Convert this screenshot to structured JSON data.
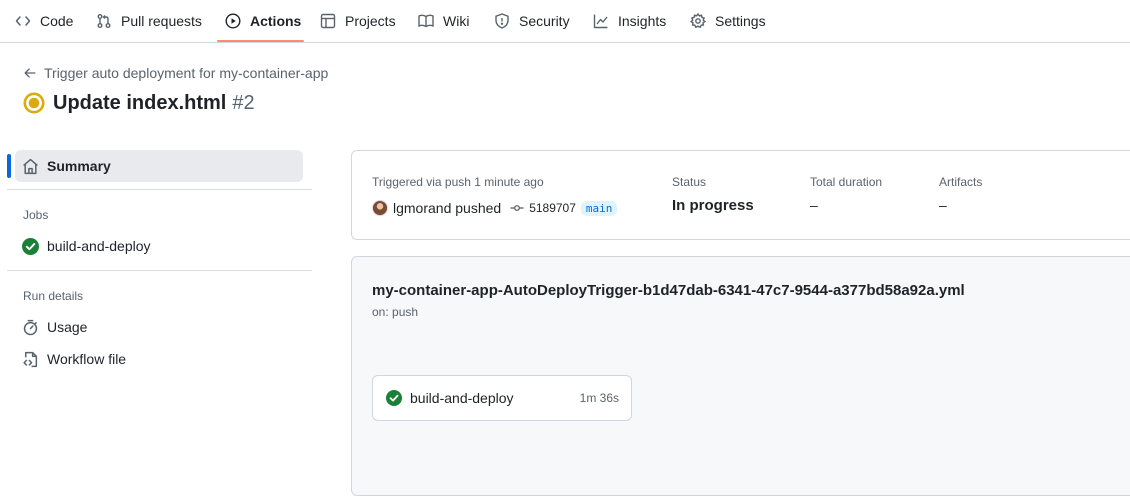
{
  "repo_nav": {
    "tabs": [
      {
        "label": "Code",
        "icon": "code-icon"
      },
      {
        "label": "Pull requests",
        "icon": "pull-request-icon"
      },
      {
        "label": "Actions",
        "icon": "play-icon",
        "active": true
      },
      {
        "label": "Projects",
        "icon": "table-icon"
      },
      {
        "label": "Wiki",
        "icon": "book-icon"
      },
      {
        "label": "Security",
        "icon": "shield-icon"
      },
      {
        "label": "Insights",
        "icon": "graph-icon"
      },
      {
        "label": "Settings",
        "icon": "gear-icon"
      }
    ],
    "active_underline_color": "#fd8c73"
  },
  "header": {
    "back_link": "Trigger auto deployment for my-container-app",
    "title": "Update index.html",
    "run_number": "#2",
    "status_icon": "in-progress-icon",
    "status_color": "#dbab0a"
  },
  "sidebar": {
    "summary_label": "Summary",
    "jobs_heading": "Jobs",
    "jobs": [
      {
        "label": "build-and-deploy",
        "status": "success"
      }
    ],
    "run_details_heading": "Run details",
    "run_details": [
      {
        "label": "Usage",
        "icon": "stopwatch-icon"
      },
      {
        "label": "Workflow file",
        "icon": "file-code-icon"
      }
    ]
  },
  "summary": {
    "triggered_label": "Triggered via push 1 minute ago",
    "actor": "lgmorand pushed",
    "commit_sha": "5189707",
    "branch": "main",
    "status_label": "Status",
    "status_value": "In progress",
    "duration_label": "Total duration",
    "duration_value": "–",
    "artifacts_label": "Artifacts",
    "artifacts_value": "–"
  },
  "workflow": {
    "name": "my-container-app-AutoDeployTrigger-b1d47dab-6341-47c7-9544-a377bd58a92a.yml",
    "on": "on: push",
    "job": {
      "name": "build-and-deploy",
      "duration": "1m 36s",
      "status": "success"
    }
  },
  "colors": {
    "accent": "#0969da",
    "success": "#1a7f37",
    "in_progress": "#dbab0a",
    "border": "#d0d7de",
    "muted_text": "#59636e"
  }
}
